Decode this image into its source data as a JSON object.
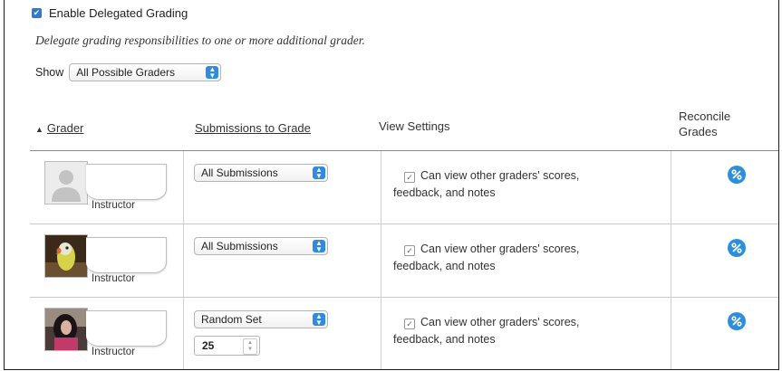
{
  "delegation": {
    "checkbox_mark": "✔",
    "enable_label": "Enable Delegated Grading",
    "description": "Delegate grading responsibilities to one or more additional grader."
  },
  "filter": {
    "show_label": "Show",
    "show_value": "All Possible Graders"
  },
  "table": {
    "headers": {
      "sort_indicator": "▲",
      "grader": "Grader",
      "submissions": "Submissions to Grade",
      "view_settings": "View Settings",
      "reconcile_line1": "Reconcile",
      "reconcile_line2": "Grades"
    },
    "rows": [
      {
        "role": "Instructor",
        "avatar": "default-person",
        "submissions": "All Submissions",
        "view_line1": "Can view other graders' scores,",
        "view_line2": "feedback, and notes",
        "view_checked": "✓"
      },
      {
        "role": "Instructor",
        "avatar": "parrot-photo",
        "submissions": "All Submissions",
        "view_line1": "Can view other graders' scores,",
        "view_line2": "feedback, and notes",
        "view_checked": "✓"
      },
      {
        "role": "Instructor",
        "avatar": "person-photo",
        "submissions": "Random Set",
        "random_count": "25",
        "view_line1": "Can view other graders' scores,",
        "view_line2": "feedback, and notes",
        "view_checked": "✓"
      }
    ]
  },
  "colors": {
    "accent": "#2b7bd4",
    "reconcile_icon": "#2d8fdc"
  },
  "icons": {
    "select_arrows": "up-down-chevron-icon",
    "reconcile": "percent-circle-icon"
  }
}
